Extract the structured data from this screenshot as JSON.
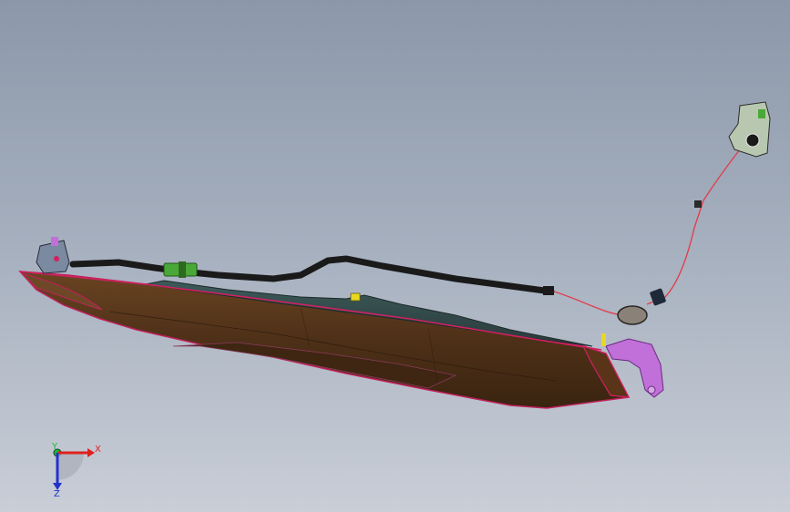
{
  "viewport": {
    "background_top": "#8c98aa",
    "background_bottom": "#c9ced7"
  },
  "triad": {
    "x_label": "X",
    "y_label": "Y",
    "z_label": "Z",
    "x_color": "#e0201c",
    "y_color": "#1fb83a",
    "z_color": "#2233cc"
  },
  "model": {
    "housing_color": "#5a3a1c",
    "trim_color": "#c0205a",
    "cable_color": "#1a1a1a",
    "wire_color": "#e04050",
    "bracket_color": "#c070d8",
    "connector_color": "#4aa838",
    "grommet_color": "#8a8278"
  }
}
